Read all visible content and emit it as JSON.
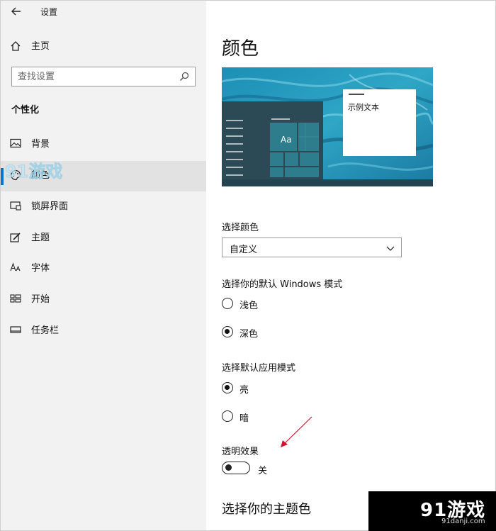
{
  "window": {
    "title": "设置"
  },
  "sidebar": {
    "home_label": "主页",
    "search_placeholder": "查找设置",
    "section_title": "个性化",
    "items": [
      {
        "label": "背景",
        "icon": "picture-icon"
      },
      {
        "label": "颜色",
        "icon": "palette-icon",
        "selected": true
      },
      {
        "label": "锁屏界面",
        "icon": "lock-screen-icon"
      },
      {
        "label": "主题",
        "icon": "theme-brush-icon"
      },
      {
        "label": "字体",
        "icon": "font-icon"
      },
      {
        "label": "开始",
        "icon": "start-tiles-icon"
      },
      {
        "label": "任务栏",
        "icon": "taskbar-icon"
      }
    ]
  },
  "main": {
    "page_title": "颜色",
    "preview": {
      "sample_text": "示例文本",
      "tile_text": "Aa"
    },
    "choose_color": {
      "label": "选择颜色",
      "value": "自定义"
    },
    "windows_mode": {
      "label": "选择你的默认 Windows 模式",
      "options": [
        {
          "label": "浅色",
          "selected": false
        },
        {
          "label": "深色",
          "selected": true
        }
      ]
    },
    "app_mode": {
      "label": "选择默认应用模式",
      "options": [
        {
          "label": "亮",
          "selected": true
        },
        {
          "label": "暗",
          "selected": false
        }
      ]
    },
    "transparency": {
      "label": "透明效果",
      "state_label": "关",
      "on": false
    },
    "accent_title": "选择你的主题色"
  },
  "colors": {
    "accent_blue": "#0b74c8",
    "preview_dark": "#2b4a56",
    "tile_teal": "#2d7d8c",
    "arrow_red": "#d4112a"
  },
  "watermark": {
    "logo_text": "91游戏",
    "site": "91danji.com"
  }
}
